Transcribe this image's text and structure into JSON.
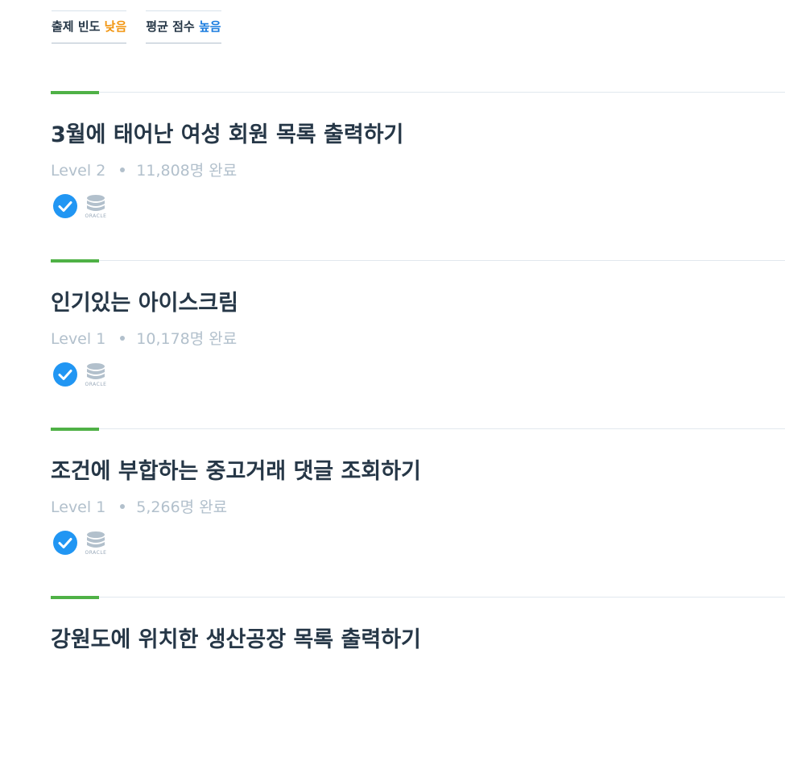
{
  "filters": [
    {
      "label": "출제 빈도",
      "value": "낮음",
      "value_color": "#f29510"
    },
    {
      "label": "평균 점수",
      "value": "높음",
      "value_color": "#1a7cdf"
    }
  ],
  "problems": [
    {
      "title": "3월에 태어난 여성 회원 목록 출력하기",
      "level": "Level 2",
      "completed": "11,808명 완료",
      "language": "ORACLE",
      "solved": true
    },
    {
      "title": "인기있는 아이스크림",
      "level": "Level 1",
      "completed": "10,178명 완료",
      "language": "ORACLE",
      "solved": true
    },
    {
      "title": "조건에 부합하는 중고거래 댓글 조회하기",
      "level": "Level 1",
      "completed": "5,266명 완료",
      "language": "ORACLE",
      "solved": true
    },
    {
      "title": "강원도에 위치한 생산공장 목록 출력하기",
      "level": "",
      "completed": "",
      "language": "",
      "solved": false
    }
  ],
  "colors": {
    "accent": "#4fb146",
    "check": "#2196f3",
    "muted": "#b2c0cc",
    "title": "#263747"
  }
}
